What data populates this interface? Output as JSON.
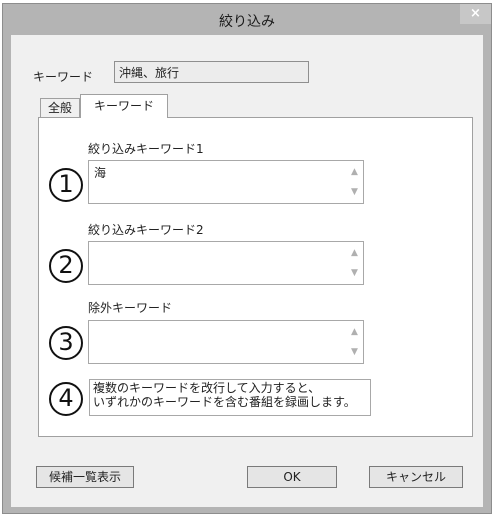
{
  "window": {
    "title": "絞り込み",
    "close_glyph": "×"
  },
  "keyword_summary": {
    "label": "キーワード",
    "value": "沖縄、旅行"
  },
  "tabs": [
    {
      "label": "全般",
      "active": false
    },
    {
      "label": "キーワード",
      "active": true
    }
  ],
  "fields": [
    {
      "marker": "1",
      "label": "絞り込みキーワード1",
      "value": "海"
    },
    {
      "marker": "2",
      "label": "絞り込みキーワード2",
      "value": ""
    },
    {
      "marker": "3",
      "label": "除外キーワード",
      "value": ""
    }
  ],
  "note": {
    "marker": "4",
    "text": "複数のキーワードを改行して入力すると、\nいずれかのキーワードを含む番組を録画します。"
  },
  "buttons": {
    "candidates": "候補一覧表示",
    "ok": "OK",
    "cancel": "キャンセル"
  },
  "icons": {
    "scroll_up": "chevron-up-icon",
    "scroll_down": "chevron-down-icon",
    "close": "close-icon"
  },
  "colors": {
    "titlebar": "#b4b4b4",
    "client": "#f0f0f0",
    "panel": "#ffffff"
  }
}
